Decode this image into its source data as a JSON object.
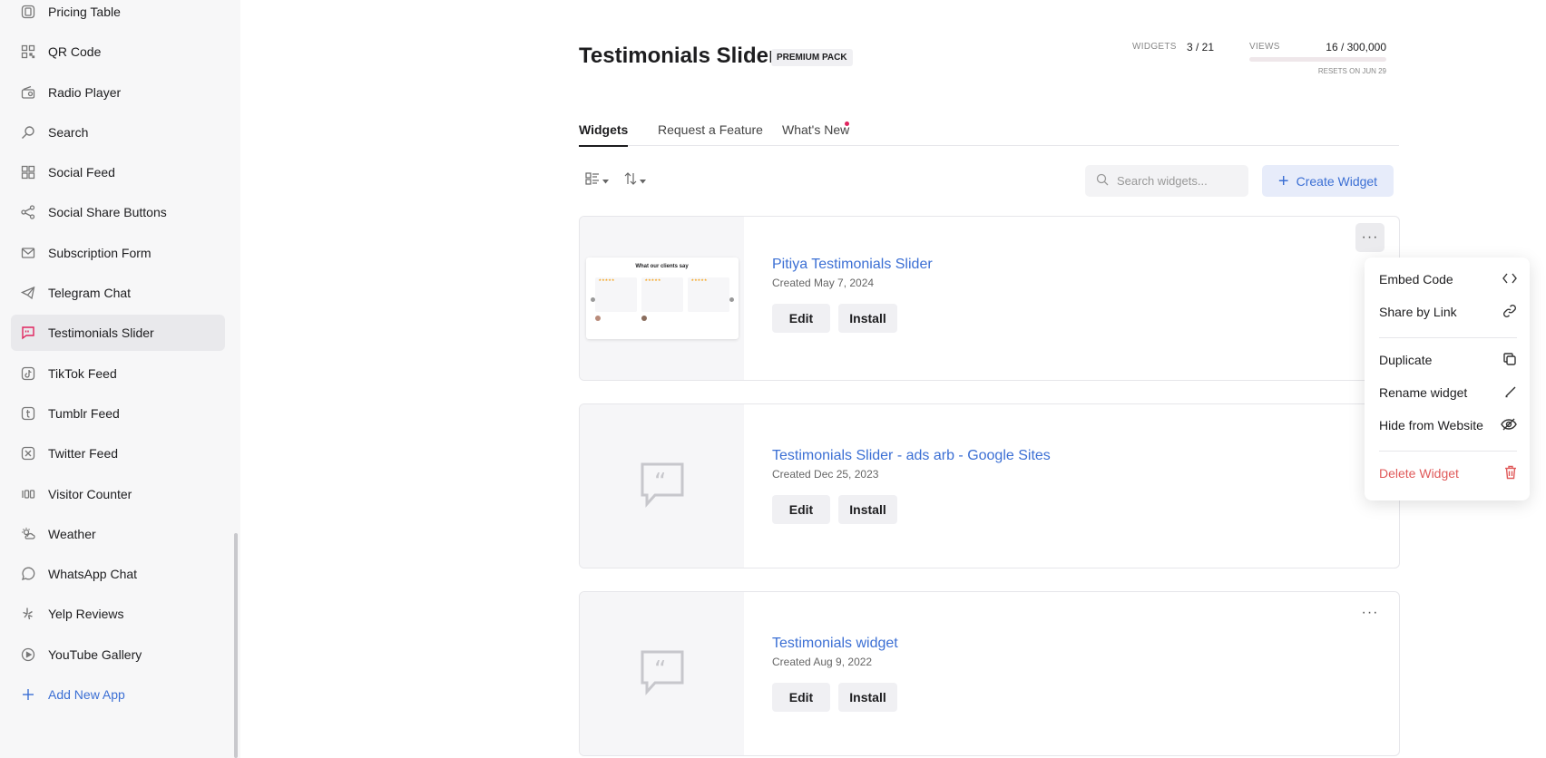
{
  "sidebar": {
    "items": [
      {
        "label": "Pricing Table",
        "icon": "pricing-table-icon"
      },
      {
        "label": "QR Code",
        "icon": "qr-code-icon"
      },
      {
        "label": "Radio Player",
        "icon": "radio-icon"
      },
      {
        "label": "Search",
        "icon": "search-icon"
      },
      {
        "label": "Social Feed",
        "icon": "social-feed-icon"
      },
      {
        "label": "Social Share Buttons",
        "icon": "share-icon"
      },
      {
        "label": "Subscription Form",
        "icon": "mail-icon"
      },
      {
        "label": "Telegram Chat",
        "icon": "telegram-icon"
      },
      {
        "label": "Testimonials Slider",
        "icon": "testimonial-icon",
        "active": true
      },
      {
        "label": "TikTok Feed",
        "icon": "tiktok-icon"
      },
      {
        "label": "Tumblr Feed",
        "icon": "tumblr-icon"
      },
      {
        "label": "Twitter Feed",
        "icon": "twitter-icon"
      },
      {
        "label": "Visitor Counter",
        "icon": "counter-icon"
      },
      {
        "label": "Weather",
        "icon": "weather-icon"
      },
      {
        "label": "WhatsApp Chat",
        "icon": "whatsapp-icon"
      },
      {
        "label": "Yelp Reviews",
        "icon": "yelp-icon"
      },
      {
        "label": "YouTube Gallery",
        "icon": "youtube-icon"
      }
    ],
    "add_label": "Add New App"
  },
  "header": {
    "title": "Testimonials Slider",
    "badge": "PREMIUM PACK",
    "widgets_label": "WIDGETS",
    "widgets_value": "3 / 21",
    "views_label": "VIEWS",
    "views_value": "16 / 300,000",
    "views_fraction": 5.33e-05,
    "resets": "RESETS ON JUN 29"
  },
  "tabs": [
    {
      "label": "Widgets",
      "active": true
    },
    {
      "label": "Request a Feature"
    },
    {
      "label": "What's New",
      "notification": true
    }
  ],
  "toolbar": {
    "search_placeholder": "Search widgets...",
    "create_label": "Create Widget"
  },
  "widgets": [
    {
      "name": "Pitiya Testimonials Slider",
      "created": "Created May 7, 2024",
      "edit": "Edit",
      "install": "Install",
      "thumb_title": "What our clients say"
    },
    {
      "name": "Testimonials Slider - ads arb - Google Sites",
      "created": "Created Dec 25, 2023",
      "edit": "Edit",
      "install": "Install"
    },
    {
      "name": "Testimonials widget",
      "created": "Created Aug 9, 2022",
      "edit": "Edit",
      "install": "Install"
    }
  ],
  "menu": {
    "items": [
      {
        "label": "Embed Code",
        "icon": "code-icon"
      },
      {
        "label": "Share by Link",
        "icon": "link-icon"
      },
      {
        "label": "Duplicate",
        "icon": "duplicate-icon"
      },
      {
        "label": "Rename widget",
        "icon": "pencil-icon"
      },
      {
        "label": "Hide from Website",
        "icon": "eye-off-icon"
      },
      {
        "label": "Delete Widget",
        "icon": "trash-icon"
      }
    ]
  },
  "colors": {
    "accent": "#3b6fd4",
    "brand": "#e0245e",
    "danger": "#e05a5a"
  }
}
